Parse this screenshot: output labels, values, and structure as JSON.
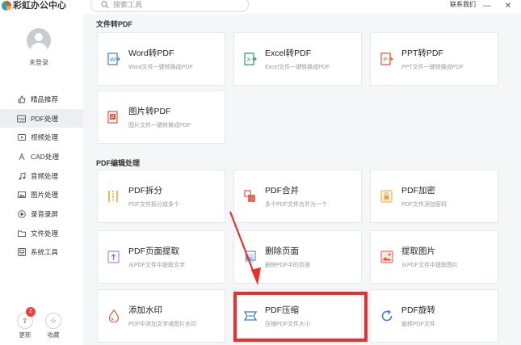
{
  "app": {
    "title": "彩虹办公中心"
  },
  "search": {
    "placeholder": "搜索工具"
  },
  "window": {
    "contact": "联系我们",
    "minimize": "—",
    "close": "✕"
  },
  "user": {
    "login_text": "未登录"
  },
  "sidebar": {
    "items": [
      {
        "label": "精品推荐",
        "icon": "thumb-icon"
      },
      {
        "label": "PDF处理",
        "icon": "pdf-icon",
        "active": true
      },
      {
        "label": "视频处理",
        "icon": "video-icon"
      },
      {
        "label": "CAD处理",
        "icon": "cad-icon"
      },
      {
        "label": "音频处理",
        "icon": "music-icon"
      },
      {
        "label": "图片处理",
        "icon": "image-icon"
      },
      {
        "label": "录音录屏",
        "icon": "record-icon"
      },
      {
        "label": "文件处理",
        "icon": "folder-icon"
      },
      {
        "label": "系统工具",
        "icon": "system-icon"
      }
    ],
    "update": {
      "label": "更新",
      "badge": "2"
    },
    "favorites": {
      "label": "收藏"
    }
  },
  "sections": {
    "to_pdf": {
      "title": "文件转PDF"
    },
    "pdf_edit": {
      "title": "PDF编辑处理"
    }
  },
  "cards": [
    {
      "title": "Word转PDF",
      "desc": "Word文件一键转换成PDF",
      "icon": "word-icon",
      "color": "#3a7fd5"
    },
    {
      "title": "Excel转PDF",
      "desc": "Excel文件一键转换成PDF",
      "icon": "excel-icon",
      "color": "#1e9c5a"
    },
    {
      "title": "PPT转PDF",
      "desc": "PPT文件一键转换成PDF",
      "icon": "ppt-icon",
      "color": "#e0553a"
    },
    {
      "title": "图片转PDF",
      "desc": "图片文件一键转换成PDF",
      "icon": "image-pdf-icon",
      "color": "#e0553a"
    },
    {
      "title": "PDF拆分",
      "desc": "PDF文件拆分成多个",
      "icon": "split-icon",
      "color": "#f2a33a"
    },
    {
      "title": "PDF合并",
      "desc": "多个PDF文件合并为一个",
      "icon": "merge-icon",
      "color": "#e0553a"
    },
    {
      "title": "PDF加密",
      "desc": "PDF文件添加密码",
      "icon": "lock-icon",
      "color": "#f2a33a"
    },
    {
      "title": "PDF页面提取",
      "desc": "从PDF文件中提取文字",
      "icon": "extract-icon",
      "color": "#9b6bd8"
    },
    {
      "title": "删除页面",
      "desc": "删除PDF中的页面",
      "icon": "delete-page-icon",
      "color": "#3a7fd5"
    },
    {
      "title": "提取图片",
      "desc": "从PDF文件中提取图片",
      "icon": "extract-image-icon",
      "color": "#e0553a"
    },
    {
      "title": "添加水印",
      "desc": "PDF中添加文字或图片水印",
      "icon": "watermark-icon",
      "color": "#e0553a"
    },
    {
      "title": "PDF压缩",
      "desc": "压缩PDF文件大小",
      "icon": "compress-icon",
      "color": "#3a7fd5"
    },
    {
      "title": "PDF旋转",
      "desc": "旋转PDF文件",
      "icon": "rotate-icon",
      "color": "#3a7fd5"
    }
  ],
  "colors": {
    "highlight": "#e8312d",
    "accent": "#3a7fd5"
  }
}
